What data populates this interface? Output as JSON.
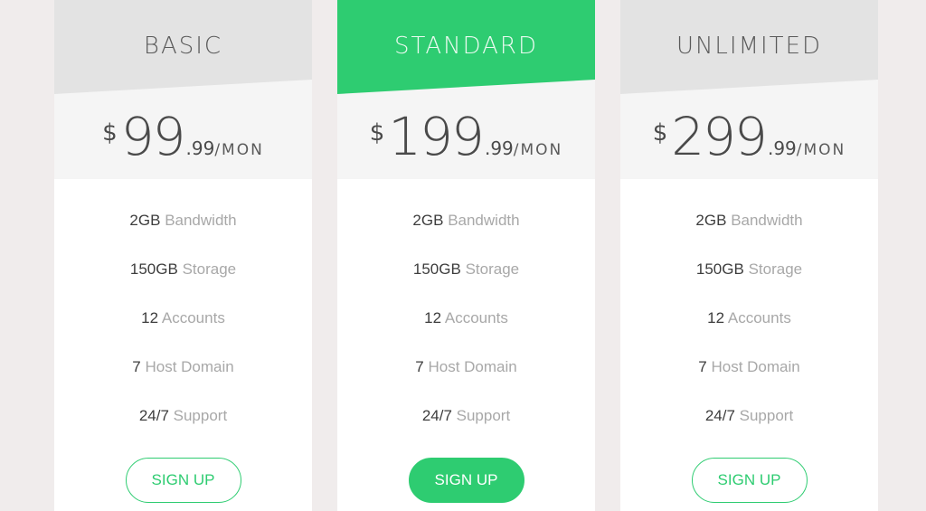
{
  "theme": {
    "accent": "#2ecc71",
    "background": "#f0ecec",
    "header_gray": "#e3e3e3",
    "price_band": "#f5f5f5"
  },
  "plans": [
    {
      "name": "BASIC",
      "featured": false,
      "currency": "$",
      "amount": "99",
      "cents": ".99",
      "period": "/MON",
      "features": [
        {
          "qty": "2GB",
          "label": "Bandwidth"
        },
        {
          "qty": "150GB",
          "label": "Storage"
        },
        {
          "qty": "12",
          "label": "Accounts"
        },
        {
          "qty": "7",
          "label": "Host Domain"
        },
        {
          "qty": "24/7",
          "label": "Support"
        }
      ],
      "cta": "SIGN UP"
    },
    {
      "name": "STANDARD",
      "featured": true,
      "currency": "$",
      "amount": "199",
      "cents": ".99",
      "period": "/MON",
      "features": [
        {
          "qty": "2GB",
          "label": "Bandwidth"
        },
        {
          "qty": "150GB",
          "label": "Storage"
        },
        {
          "qty": "12",
          "label": "Accounts"
        },
        {
          "qty": "7",
          "label": "Host Domain"
        },
        {
          "qty": "24/7",
          "label": "Support"
        }
      ],
      "cta": "SIGN UP"
    },
    {
      "name": "UNLIMITED",
      "featured": false,
      "currency": "$",
      "amount": "299",
      "cents": ".99",
      "period": "/MON",
      "features": [
        {
          "qty": "2GB",
          "label": "Bandwidth"
        },
        {
          "qty": "150GB",
          "label": "Storage"
        },
        {
          "qty": "12",
          "label": "Accounts"
        },
        {
          "qty": "7",
          "label": "Host Domain"
        },
        {
          "qty": "24/7",
          "label": "Support"
        }
      ],
      "cta": "SIGN UP"
    }
  ]
}
